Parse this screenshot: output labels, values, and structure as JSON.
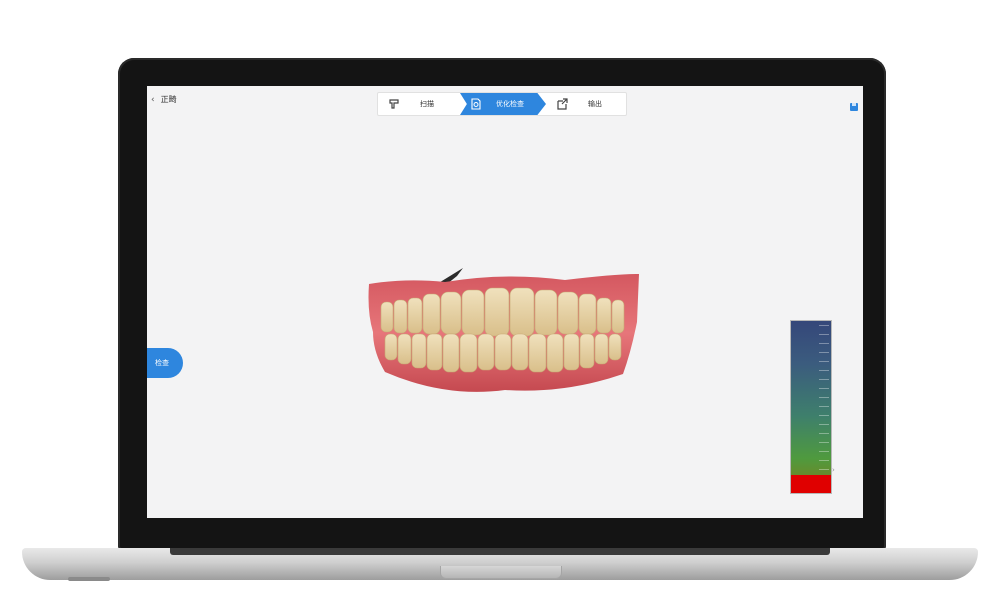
{
  "app": {
    "back_label": "正畸"
  },
  "stepper": {
    "steps": [
      {
        "label": "扫描",
        "icon": "scan-icon",
        "active": false
      },
      {
        "label": "优化检查",
        "icon": "inspect-icon",
        "active": true
      },
      {
        "label": "输出",
        "icon": "export-icon",
        "active": false
      }
    ],
    "active_color": "#2e86de"
  },
  "side_panel": {
    "label": "检查"
  },
  "viewport": {
    "model": "dental-arch-3d-model",
    "color_scale": {
      "colors": [
        "#35477a",
        "#3e7f6c",
        "#4f9a3e",
        "#e00000"
      ]
    }
  }
}
